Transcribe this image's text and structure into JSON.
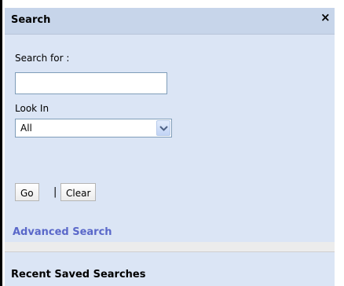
{
  "search_panel": {
    "title": "Search",
    "close_icon": "close-icon",
    "close_glyph": "×",
    "search_for_label": "Search for :",
    "search_input_value": "",
    "look_in_label": "Look In",
    "look_in_selected": "All",
    "go_label": "Go",
    "separator": "|",
    "clear_label": "Clear",
    "advanced_search_label": "Advanced Search"
  },
  "recent_panel": {
    "title": "Recent Saved Searches"
  },
  "colors": {
    "header_bg": "#c7d5ea",
    "body_bg": "#dbe5f5",
    "link": "#5a68c9",
    "left_border": "#000000"
  }
}
